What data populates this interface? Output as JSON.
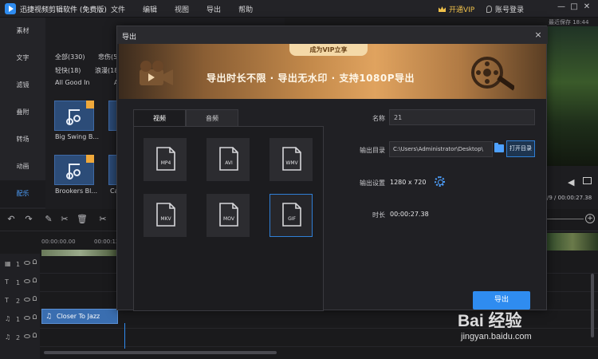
{
  "app": {
    "title": "迅捷视频剪辑软件 (免费版)",
    "menu": [
      "文件",
      "编辑",
      "视图",
      "导出",
      "帮助"
    ],
    "vip_label": "开通VIP",
    "account_label": "账号登录",
    "window_controls": [
      "—",
      "□",
      "✕"
    ],
    "last_saved": "最近保存 18:44"
  },
  "left_nav": [
    {
      "label": "素材",
      "active": false
    },
    {
      "label": "文字",
      "active": false
    },
    {
      "label": "滤镜",
      "active": false
    },
    {
      "label": "叠附",
      "active": false
    },
    {
      "label": "转场",
      "active": false
    },
    {
      "label": "动画",
      "active": false
    },
    {
      "label": "配乐",
      "active": true
    }
  ],
  "material_panel": {
    "categories": [
      "全部(330)",
      "悲伤(58",
      "轻快(18)",
      "浪漫(18",
      "All Good In",
      "A"
    ],
    "tiles": [
      {
        "label": "Big Swing B..."
      },
      {
        "label": "Brookers Bl..."
      },
      {
        "label": "Ca"
      }
    ]
  },
  "preview": {
    "time_readout": "/9 / 00:00:27.38"
  },
  "timeline": {
    "tools": [
      "↶",
      "↷",
      "✎",
      "✂",
      "🗑",
      "✂"
    ],
    "ruler_labels": [
      "00:00:00.00",
      "00:00:12.5"
    ],
    "tracks": [
      {
        "icon": "▦",
        "num": "1"
      },
      {
        "icon": "T",
        "num": "1"
      },
      {
        "icon": "T",
        "num": "2"
      },
      {
        "icon": "♫",
        "num": "1"
      },
      {
        "icon": "♫",
        "num": "2"
      }
    ],
    "audio_clip_label": "Closer To Jazz"
  },
  "dialog": {
    "title": "导出",
    "close": "×",
    "banner": {
      "vip_pill": "成为VIP立享",
      "slogan": "导出时长不限 · 导出无水印 · 支持1080P导出"
    },
    "tabs": [
      {
        "label": "视频",
        "active": true
      },
      {
        "label": "音频",
        "active": false
      }
    ],
    "formats": [
      {
        "label": "MP4",
        "selected": false
      },
      {
        "label": "AVI",
        "selected": false
      },
      {
        "label": "WMV",
        "selected": false
      },
      {
        "label": "MKV",
        "selected": false
      },
      {
        "label": "MOV",
        "selected": false
      },
      {
        "label": "GIF",
        "selected": true
      }
    ],
    "fields": {
      "name_label": "名称",
      "name_value": "21",
      "output_dir_label": "输出目录",
      "output_dir_value": "C:\\Users\\Administrator\\Desktop\\",
      "open_dir_button": "打开目录",
      "settings_label": "输出设置",
      "settings_value": "1280 x 720",
      "duration_label": "时长",
      "duration_value": "00:00:27.38"
    },
    "export_button": "导出"
  },
  "watermark": {
    "logo_text": "Bai 经验",
    "url": "jingyan.baidu.com"
  },
  "colors": {
    "accent": "#2f8cf0",
    "vip_gold": "#f0c14b",
    "background": "#1b1b1d"
  }
}
